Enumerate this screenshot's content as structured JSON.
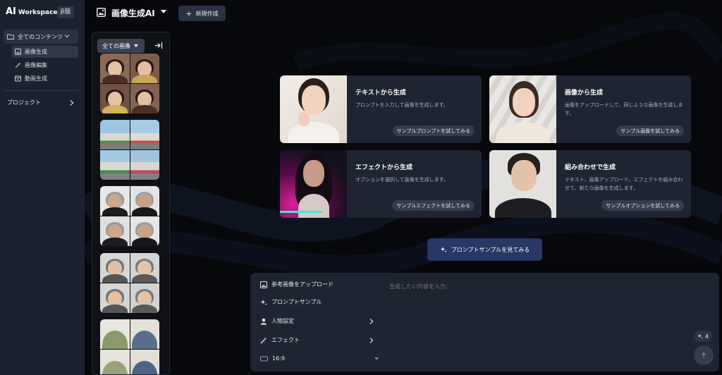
{
  "sidebar": {
    "brand_ai": "AI",
    "brand_workspace": "Workspace",
    "beta_badge": "β版",
    "all_contents": "全てのコンテンツ",
    "items": [
      {
        "label": "画像生成",
        "icon": "image-icon",
        "active": true
      },
      {
        "label": "画像編集",
        "icon": "magic-wand-icon",
        "active": false
      },
      {
        "label": "動画生成",
        "icon": "video-icon",
        "active": false
      }
    ],
    "project": "プロジェクト"
  },
  "header": {
    "title": "画像生成AI",
    "new_button": "新規作成"
  },
  "gallery": {
    "filter_label": "全ての画像"
  },
  "cards": [
    {
      "title": "テキストから生成",
      "desc": "プロンプトを入力して画像を生成します。",
      "button": "サンプルプロンプトを試してみる"
    },
    {
      "title": "画像から生成",
      "desc": "画像をアップロードして、同じような画像を生成します。",
      "button": "サンプル画像を試してみる"
    },
    {
      "title": "エフェクトから生成",
      "desc": "オプションを選択して画像を生成します。",
      "button": "サンプルエフェクトを試してみる"
    },
    {
      "title": "組み合わせで生成",
      "desc": "テキスト、画像アップロード、エフェクトを組み合わせて、新たな画像を生成します。",
      "button": "サンプルオプションを試してみる"
    }
  ],
  "prompt_sample_button": "プロンプトサンプルを見てみる",
  "composer": {
    "upload": "参考画像をアップロード",
    "prompt_sample": "プロンプトサンプル",
    "person": "人物設定",
    "effect": "エフェクト",
    "aspect": "16:9",
    "placeholder": "生成したい内容を入力...",
    "credits": "4"
  }
}
